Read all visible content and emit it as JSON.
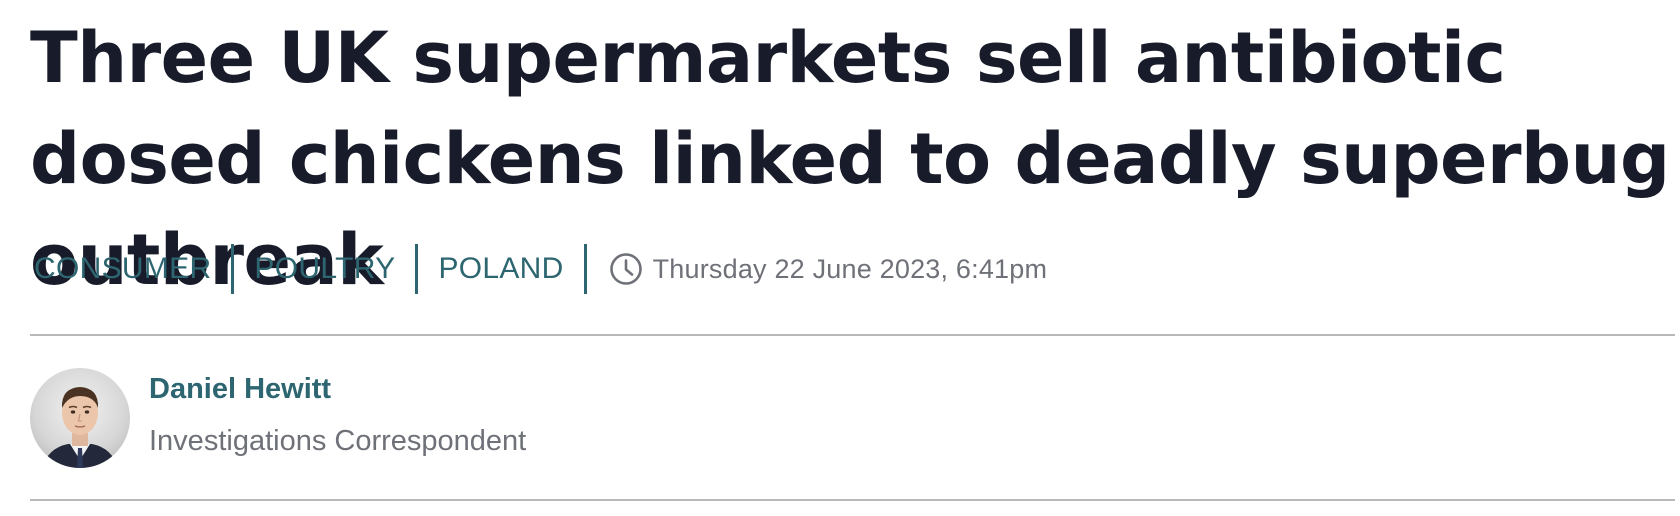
{
  "article": {
    "headline": "Three UK supermarkets sell antibiotic dosed chickens linked to deadly superbug outbreak",
    "tags": [
      {
        "label": "CONSUMER"
      },
      {
        "label": "POULTRY"
      },
      {
        "label": "POLAND"
      }
    ],
    "published": "Thursday 22 June 2023, 6:41pm"
  },
  "author": {
    "name": "Daniel Hewitt",
    "role": "Investigations Correspondent",
    "avatar_icon": "author-photo"
  },
  "icons": {
    "timestamp_icon": "clock-icon"
  },
  "colors": {
    "headline": "#181b2a",
    "accent": "#2d6670",
    "muted_text": "#6f7178",
    "divider": "#b9b9bb"
  }
}
